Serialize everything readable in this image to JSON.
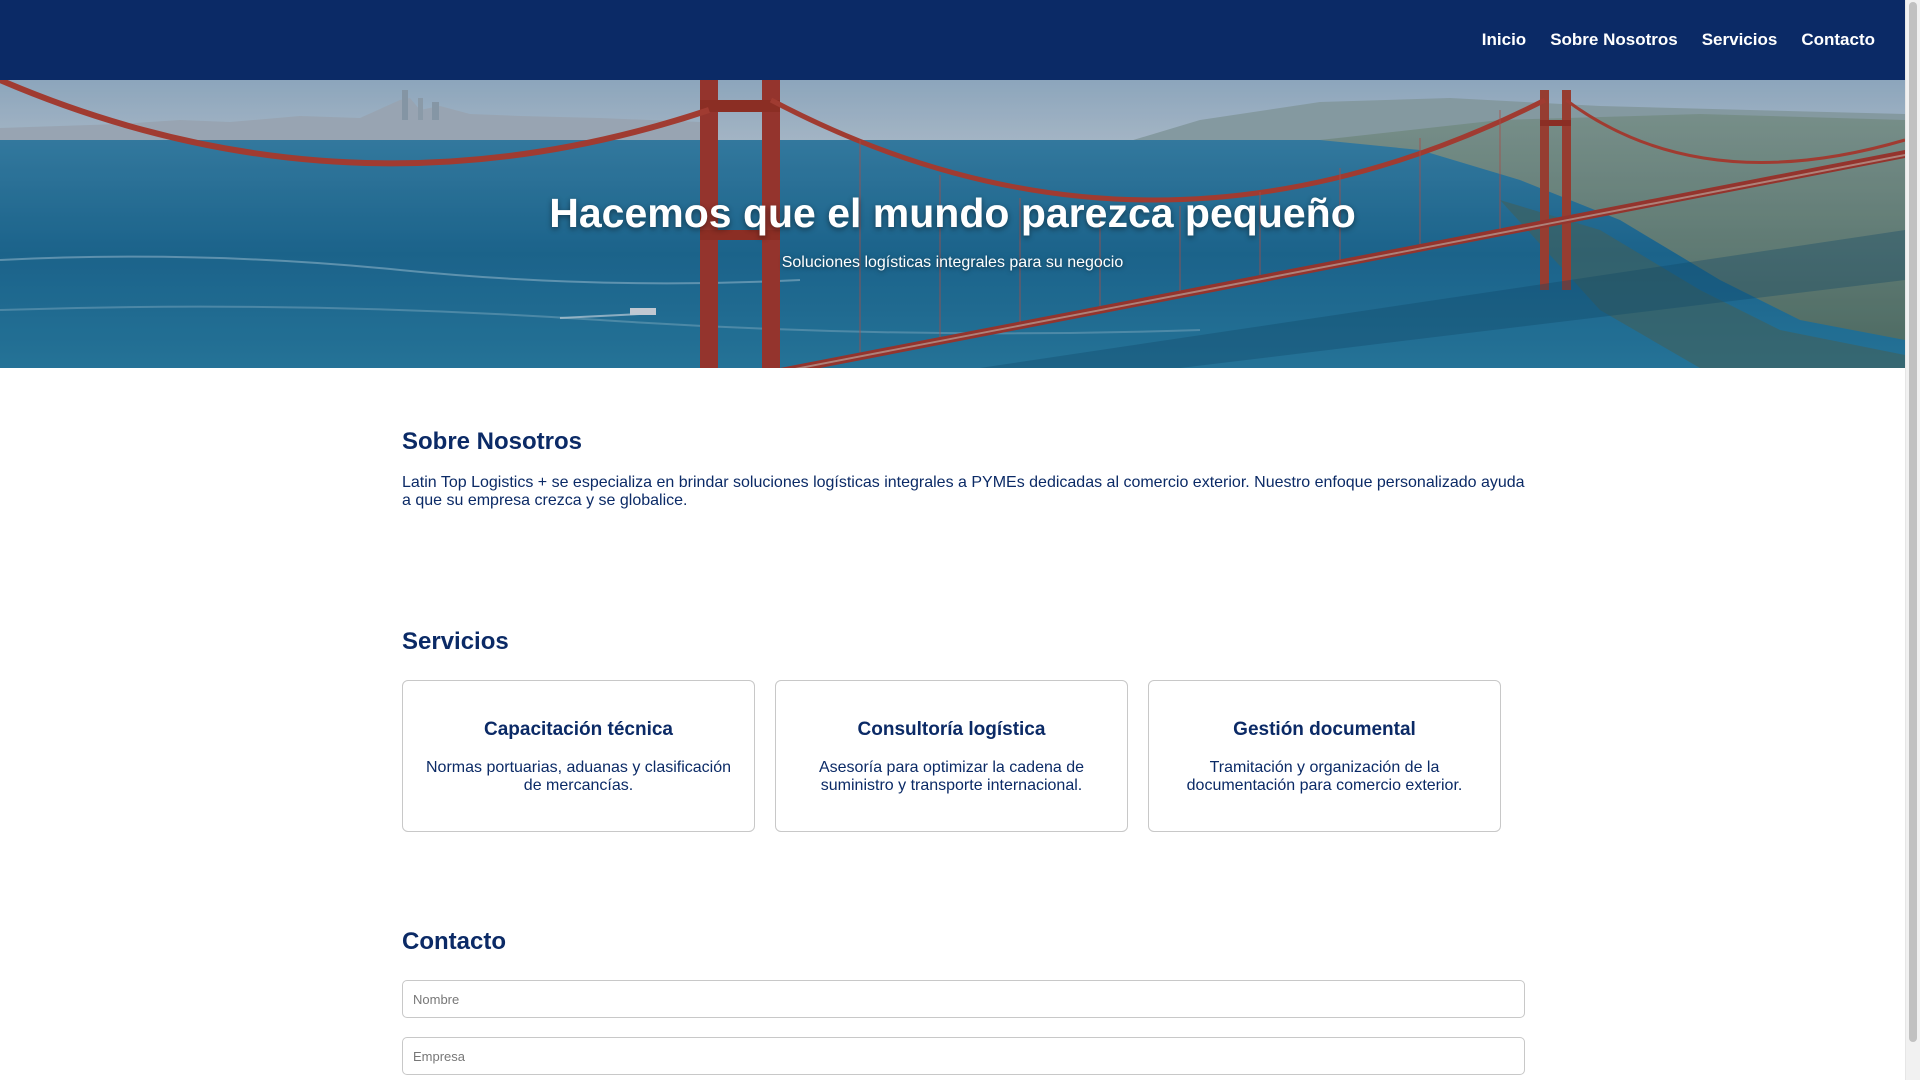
{
  "nav": {
    "items": [
      {
        "label": "Inicio"
      },
      {
        "label": "Sobre Nosotros"
      },
      {
        "label": "Servicios"
      },
      {
        "label": "Contacto"
      }
    ]
  },
  "hero": {
    "title": "Hacemos que el mundo parezca pequeño",
    "subtitle": "Soluciones logísticas integrales para su negocio"
  },
  "about": {
    "title": "Sobre Nosotros",
    "text": "Latin Top Logistics + se especializa en brindar soluciones logísticas integrales a PYMEs dedicadas al comercio exterior. Nuestro enfoque personalizado ayuda a que su empresa crezca y se globalice."
  },
  "services": {
    "title": "Servicios",
    "cards": [
      {
        "title": "Capacitación técnica",
        "text": "Normas portuarias, aduanas y clasificación de mercancías."
      },
      {
        "title": "Consultoría logística",
        "text": "Asesoría para optimizar la cadena de suministro y transporte internacional."
      },
      {
        "title": "Gestión documental",
        "text": "Tramitación y organización de la documentación para comercio exterior."
      }
    ]
  },
  "contact": {
    "title": "Contacto",
    "fields": [
      {
        "placeholder": "Nombre"
      },
      {
        "placeholder": "Empresa"
      }
    ]
  },
  "colors": {
    "navbar": "#0b2a66",
    "heading": "#0b2a66",
    "bridge": "#c0392b"
  }
}
